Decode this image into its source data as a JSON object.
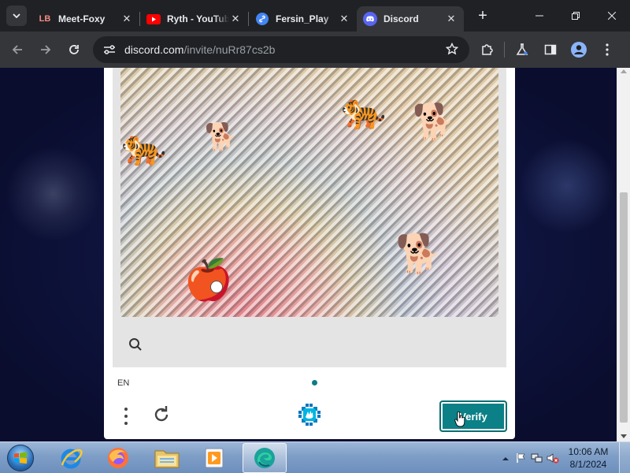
{
  "browser": {
    "tabs": [
      {
        "title": "Meet-Foxy",
        "favicon_text": "LB",
        "favicon_color": "#f28b82",
        "active": false
      },
      {
        "title": "Ryth - YouTube",
        "favicon": "youtube-icon",
        "favicon_color": "#ff0000",
        "active": false
      },
      {
        "title": "Fersin_Play",
        "favicon": "link-icon",
        "favicon_color": "#4285f4",
        "active": false
      },
      {
        "title": "Discord",
        "favicon": "discord-icon",
        "favicon_color": "#5865f2",
        "active": true
      }
    ],
    "url_host": "discord.com",
    "url_path": "/invite/nuRr87cs2b"
  },
  "captcha": {
    "language": "EN",
    "verify_label": "Verify",
    "accent_color": "#0b8087",
    "image_objects": [
      "tiger",
      "dog",
      "tiger",
      "dog",
      "apple",
      "dog"
    ]
  },
  "taskbar": {
    "time": "10:06 AM",
    "date": "8/1/2024",
    "apps": [
      "internet-explorer",
      "firefox",
      "file-explorer",
      "media-player",
      "edge"
    ]
  }
}
